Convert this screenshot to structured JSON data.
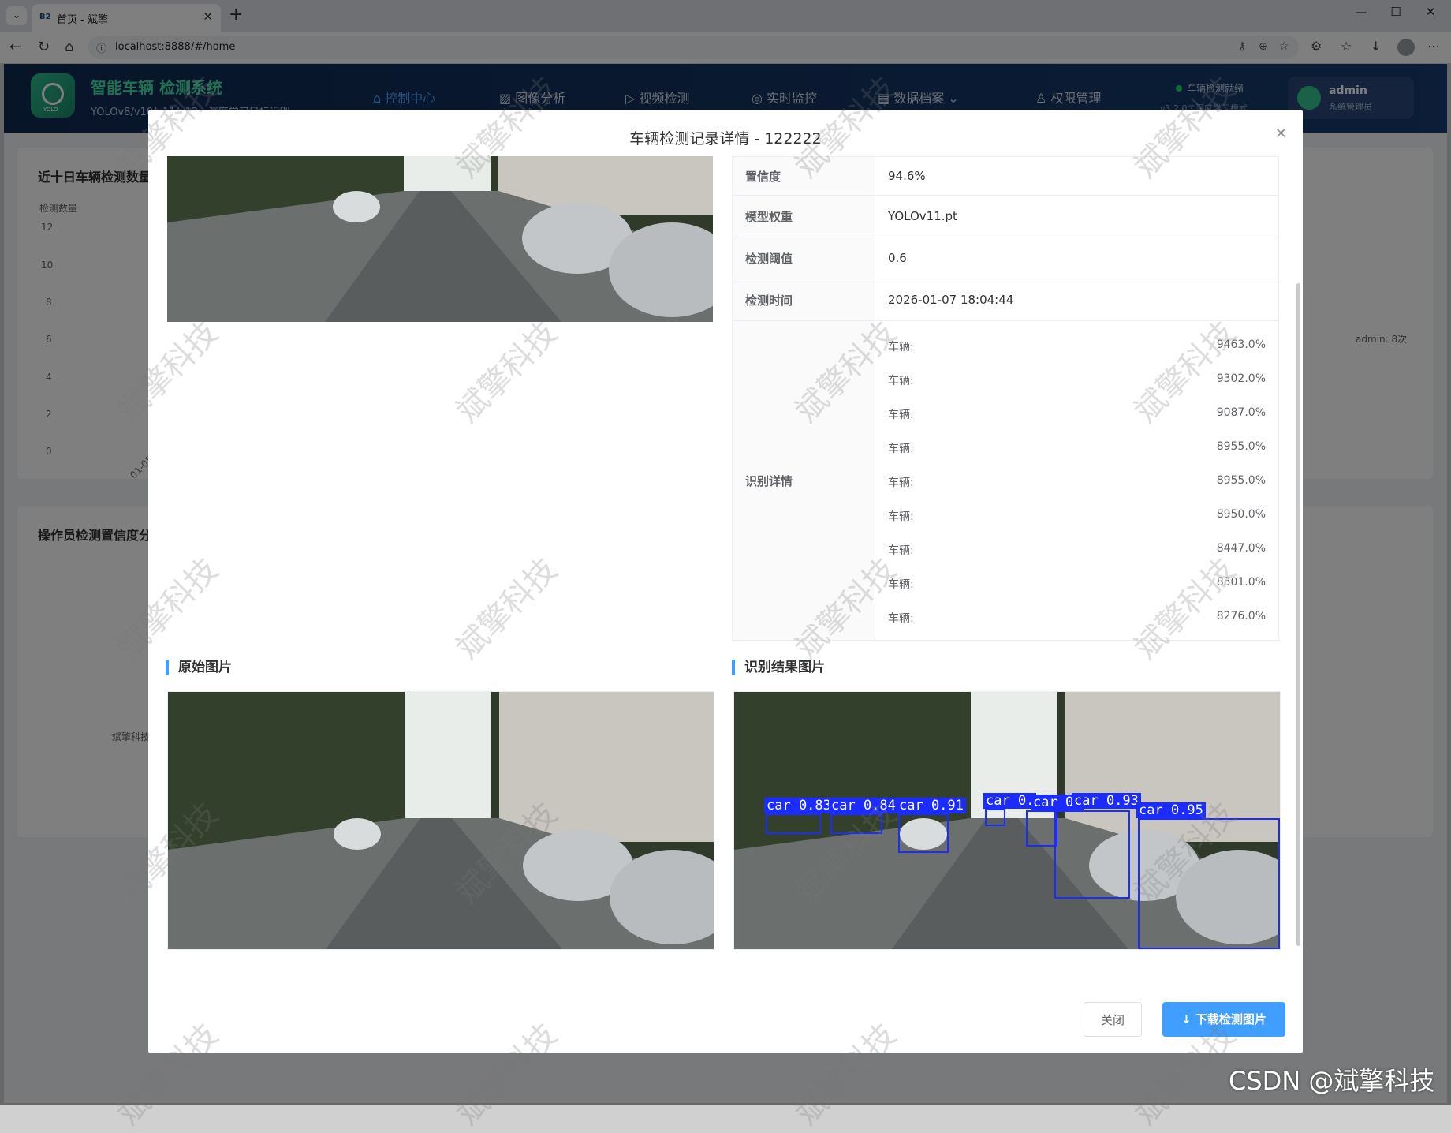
{
  "browser": {
    "tab_favicon": "B2",
    "tab_title": "首页 - 斌擎",
    "url": "localhost:8888/#/home"
  },
  "app": {
    "name": "智能车辆 检测系统",
    "subtitle": "YOLOv8/v10/v11/v12 · 深度学习目标识别",
    "logo_text": "YOLO",
    "nav": [
      {
        "label": "控制中心",
        "icon": "home-icon"
      },
      {
        "label": "图像分析",
        "icon": "image-icon"
      },
      {
        "label": "视频检测",
        "icon": "play-icon"
      },
      {
        "label": "实时监控",
        "icon": "camera-icon"
      },
      {
        "label": "数据档案",
        "icon": "document-icon"
      },
      {
        "label": "权限管理",
        "icon": "user-icon"
      }
    ],
    "status": "车辆检测就绪",
    "version": "v3.2.0 · 深度学习模式",
    "user": {
      "name": "admin",
      "role": "系统管理员"
    },
    "colors": {
      "header": "#0f2a52",
      "accent": "#409eff",
      "brand": "#43e0a5"
    }
  },
  "background": {
    "card1_title": "近十日车辆检测数量",
    "y_axis_label": "检测数量",
    "y_ticks": [
      "12",
      "10",
      "8",
      "6",
      "4",
      "2",
      "0"
    ],
    "x_tick": "01-05",
    "pie_label": "admin: 8次",
    "card2_title": "操作员检测置信度分",
    "card2_label": "斌擎科技"
  },
  "dialog": {
    "title": "车辆检测记录详情 - 122222",
    "fields": [
      {
        "label": "置信度",
        "value": "94.6%"
      },
      {
        "label": "模型权重",
        "value": "YOLOv11.pt"
      },
      {
        "label": "检测阈值",
        "value": "0.6"
      },
      {
        "label": "检测时间",
        "value": "2026-01-07 18:04:44"
      }
    ],
    "details_label": "识别详情",
    "details": [
      {
        "name": "车辆:",
        "value": "9463.0%"
      },
      {
        "name": "车辆:",
        "value": "9302.0%"
      },
      {
        "name": "车辆:",
        "value": "9087.0%"
      },
      {
        "name": "车辆:",
        "value": "8955.0%"
      },
      {
        "name": "车辆:",
        "value": "8955.0%"
      },
      {
        "name": "车辆:",
        "value": "8950.0%"
      },
      {
        "name": "车辆:",
        "value": "8447.0%"
      },
      {
        "name": "车辆:",
        "value": "8301.0%"
      },
      {
        "name": "车辆:",
        "value": "8276.0%"
      }
    ],
    "original_title": "原始图片",
    "result_title": "识别结果图片",
    "bbox_labels": [
      "car 0.83",
      "car 0.84",
      "car 0.91",
      "car 0.",
      "car 0.",
      "car 0.93",
      "car 0.95"
    ],
    "close_label": "关闭",
    "download_label": "下载检测图片"
  },
  "watermark": "斌擎科技",
  "csdn": "CSDN @斌擎科技"
}
